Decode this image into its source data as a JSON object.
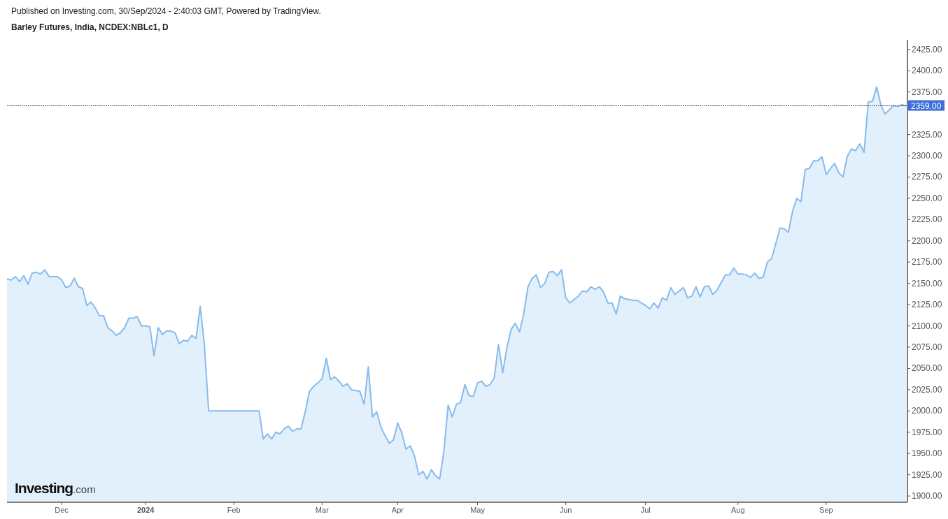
{
  "header": {
    "published": "Published on Investing.com, 30/Sep/2024 - 2:40:03 GMT, Powered by TradingView.",
    "title": "Barley Futures, India, NCDEX:NBLc1, D"
  },
  "chart": {
    "chart_data": {
      "type": "area",
      "ylim": [
        1893.5,
        2435.5
      ],
      "categories": [
        null,
        null,
        null,
        null,
        null,
        null,
        null,
        null,
        null,
        null,
        null,
        null,
        null,
        "Dec",
        null,
        null,
        null,
        null,
        null,
        null,
        null,
        null,
        null,
        null,
        null,
        null,
        null,
        null,
        null,
        null,
        null,
        null,
        null,
        "2024",
        null,
        null,
        null,
        null,
        null,
        null,
        null,
        null,
        null,
        null,
        null,
        null,
        null,
        null,
        null,
        null,
        null,
        null,
        null,
        null,
        "Feb",
        null,
        null,
        null,
        null,
        null,
        null,
        null,
        null,
        null,
        null,
        null,
        null,
        null,
        null,
        null,
        null,
        null,
        null,
        null,
        null,
        "Mar",
        null,
        null,
        null,
        null,
        null,
        null,
        null,
        null,
        null,
        null,
        null,
        null,
        null,
        null,
        null,
        null,
        null,
        "Apr",
        null,
        null,
        null,
        null,
        null,
        null,
        null,
        null,
        null,
        null,
        null,
        null,
        null,
        null,
        null,
        null,
        null,
        null,
        "May",
        null,
        null,
        null,
        null,
        null,
        null,
        null,
        null,
        null,
        null,
        null,
        null,
        null,
        null,
        null,
        null,
        null,
        null,
        null,
        null,
        "Jun",
        null,
        null,
        null,
        null,
        null,
        null,
        null,
        null,
        null,
        null,
        null,
        null,
        null,
        null,
        null,
        null,
        null,
        null,
        "Jul",
        null,
        null,
        null,
        null,
        null,
        null,
        null,
        null,
        null,
        null,
        null,
        null,
        null,
        null,
        null,
        null,
        null,
        null,
        null,
        null,
        null,
        "Aug",
        null,
        null,
        null,
        null,
        null,
        null,
        null,
        null,
        null,
        null,
        null,
        null,
        null,
        null,
        null,
        null,
        null,
        null,
        null,
        null,
        "Sep",
        null,
        null,
        null,
        null,
        null,
        null,
        null,
        null,
        null,
        null,
        null,
        null,
        null,
        null,
        null,
        null,
        null,
        null,
        null
      ],
      "series": [
        {
          "color": "#88bbee",
          "values": [
            2155,
            2154,
            2158,
            2152,
            2159,
            2149,
            2162,
            2163,
            2161,
            2166,
            2158,
            2158,
            2158,
            2154,
            2145,
            2147,
            2156,
            2146,
            2144,
            2124,
            2128,
            2121,
            2112,
            2112,
            2098,
            2094,
            2089,
            2092,
            2098,
            2109,
            2109,
            2111,
            2100,
            2100,
            2099,
            2065,
            2098,
            2090,
            2094,
            2094,
            2092,
            2079,
            2083,
            2082,
            2089,
            2085,
            2123,
            2077,
            2000,
            2000,
            2000,
            2000,
            2000,
            2000,
            2000,
            2000,
            2000,
            2000,
            2000,
            2000,
            2000,
            1967,
            1973,
            1967,
            1975,
            1973,
            1979,
            1982,
            1976,
            1979,
            1979,
            1999,
            2023,
            2029,
            2033,
            2038,
            2062,
            2037,
            2040,
            2035,
            2029,
            2032,
            2025,
            2024,
            2023,
            2008,
            2052,
            1993,
            1999,
            1981,
            1971,
            1962,
            1966,
            1986,
            1974,
            1955,
            1959,
            1947,
            1925,
            1929,
            1920,
            1931,
            1924,
            1920,
            1953,
            2007,
            1993,
            2008,
            2010,
            2031,
            2018,
            2017,
            2033,
            2035,
            2029,
            2031,
            2039,
            2078,
            2045,
            2075,
            2096,
            2103,
            2093,
            2114,
            2146,
            2156,
            2160,
            2145,
            2150,
            2163,
            2164,
            2159,
            2166,
            2133,
            2127,
            2131,
            2135,
            2141,
            2140,
            2146,
            2143,
            2146,
            2140,
            2127,
            2127,
            2114,
            2135,
            2132,
            2131,
            2130,
            2130,
            2127,
            2124,
            2120,
            2127,
            2121,
            2133,
            2130,
            2145,
            2137,
            2141,
            2145,
            2133,
            2135,
            2146,
            2134,
            2146,
            2147,
            2137,
            2142,
            2151,
            2160,
            2160,
            2168,
            2161,
            2161,
            2160,
            2157,
            2162,
            2156,
            2157,
            2175,
            2179,
            2197,
            2215,
            2214,
            2210,
            2235,
            2250,
            2246,
            2284,
            2285,
            2294,
            2294,
            2299,
            2278,
            2285,
            2291,
            2280,
            2275,
            2299,
            2308,
            2306,
            2314,
            2304,
            2363,
            2364,
            2381,
            2360,
            2349,
            2354,
            2359,
            2358,
            2360,
            2359
          ]
        }
      ],
      "yticks": [
        {
          "value": 1900,
          "label": "1900.00"
        },
        {
          "value": 1925,
          "label": "1925.00"
        },
        {
          "value": 1950,
          "label": "1950.00"
        },
        {
          "value": 1975,
          "label": "1975.00"
        },
        {
          "value": 2000,
          "label": "2000.00"
        },
        {
          "value": 2025,
          "label": "2025.00"
        },
        {
          "value": 2050,
          "label": "2050.00"
        },
        {
          "value": 2075,
          "label": "2075.00"
        },
        {
          "value": 2100,
          "label": "2100.00"
        },
        {
          "value": 2125,
          "label": "2125.00"
        },
        {
          "value": 2150,
          "label": "2150.00"
        },
        {
          "value": 2175,
          "label": "2175.00"
        },
        {
          "value": 2200,
          "label": "2200.00"
        },
        {
          "value": 2225,
          "label": "2225.00"
        },
        {
          "value": 2250,
          "label": "2250.00"
        },
        {
          "value": 2275,
          "label": "2275.00"
        },
        {
          "value": 2300,
          "label": "2300.00"
        },
        {
          "value": 2325,
          "label": "2325.00"
        },
        {
          "value": 2375,
          "label": "2375.00"
        },
        {
          "value": 2400,
          "label": "2400.00"
        },
        {
          "value": 2425,
          "label": "2425.00"
        }
      ],
      "ref_lines": [
        {
          "axis": "y",
          "value": 2359,
          "label": "2359.00"
        }
      ]
    }
  },
  "logo": {
    "name": "Investing",
    "suffix": ".com"
  }
}
